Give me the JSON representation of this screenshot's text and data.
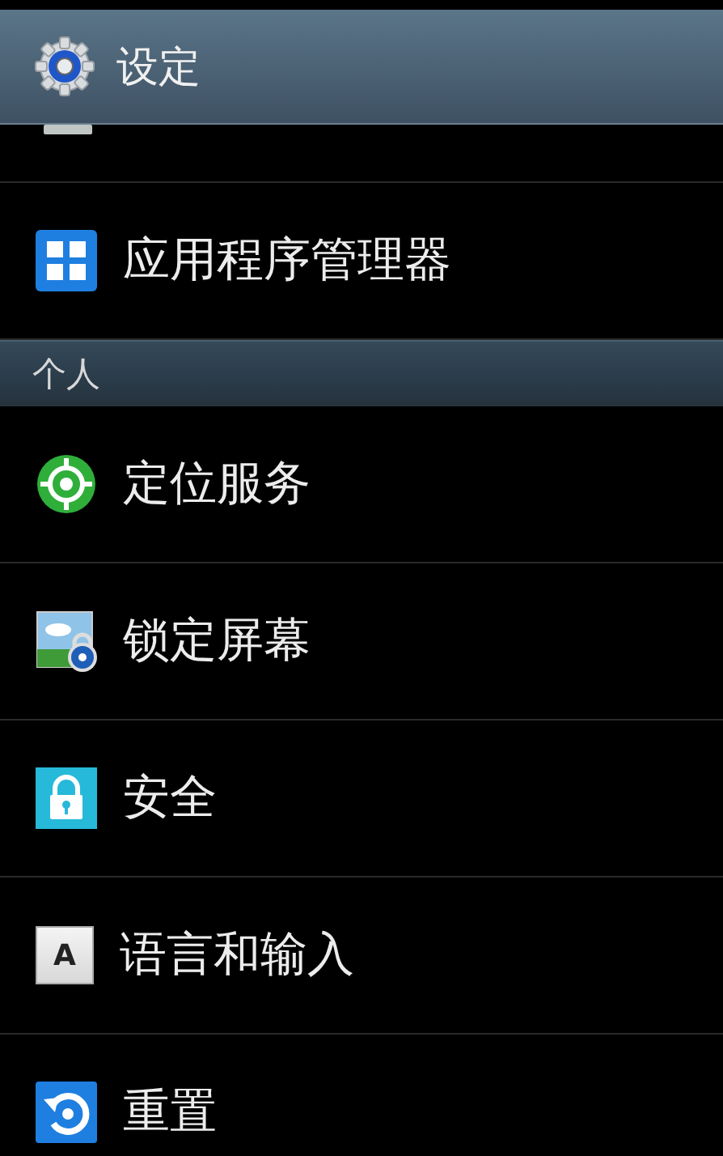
{
  "action_bar": {
    "title": "设定"
  },
  "sections": [
    {
      "items": [
        {
          "kind": "partial"
        },
        {
          "kind": "apps",
          "label": "应用程序管理器"
        }
      ]
    },
    {
      "header": "个人",
      "items": [
        {
          "kind": "location",
          "label": "定位服务"
        },
        {
          "kind": "lockscreen",
          "label": "锁定屏幕"
        },
        {
          "kind": "security",
          "label": "安全"
        },
        {
          "kind": "language",
          "label": "语言和输入",
          "icon_text": "A"
        },
        {
          "kind": "reset",
          "label": "重置"
        }
      ]
    }
  ]
}
